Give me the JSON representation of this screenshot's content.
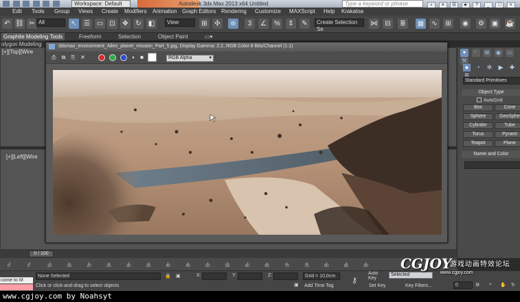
{
  "titlebar": {
    "workspace": "Workspace: Default",
    "app_title": "Autodesk 3ds Max  2013 x64      Untitled",
    "search_placeholder": "Type a keyword or phrase"
  },
  "menu": [
    "Edit",
    "Tools",
    "Group",
    "Views",
    "Create",
    "Modifiers",
    "Animation",
    "Graph Editors",
    "Rendering",
    "Customize",
    "MAXScript",
    "Help",
    "Krakatoa"
  ],
  "toolbar": {
    "filter_value": "All",
    "refcoord_value": "View",
    "selection_set_placeholder": "Create Selection Se"
  },
  "ribbon": {
    "tabs": [
      "Graphite Modeling Tools",
      "Freeform",
      "Selection",
      "Object Paint"
    ],
    "sub_label": "olygon Modeling"
  },
  "viewports": {
    "top_label": "[+][Top][Wire",
    "left_label": "[+][Left][Wire"
  },
  "render_window": {
    "title": "3dsmax_environment_Alien_planet_mission_Part_5.jpg, Display Gamma: 2.2, RGB Color 8 Bits/Channel (1:1)",
    "channel_select": "RGB Alpha",
    "channel_colors": [
      "#d92b2b",
      "#2ea84a",
      "#2c4fd6"
    ]
  },
  "command_panel": {
    "dropdown": "Standard Primitives",
    "object_type_header": "Object Type",
    "autogrid_label": "AutoGrid",
    "primitives": [
      [
        "Box",
        "Cone"
      ],
      [
        "Sphere",
        "GeoSphe"
      ],
      [
        "Cylinder",
        "Tube"
      ],
      [
        "Torus",
        "Pyrami"
      ],
      [
        "Teapot",
        "Plane"
      ]
    ],
    "name_color_header": "Name and Color"
  },
  "timeline": {
    "frame_counter": "0 / 100",
    "ticks": [
      "0",
      "5",
      "10",
      "15",
      "20",
      "25",
      "30",
      "35",
      "40",
      "45",
      "50",
      "55",
      "60",
      "65",
      "70",
      "75",
      "80",
      "85",
      "90"
    ]
  },
  "status": {
    "selection": "None Selected",
    "prompt": "Click or click-and-drag to select objects",
    "x_label": "X:",
    "y_label": "Y:",
    "z_label": "Z:",
    "grid": "Grid = 10,0cm",
    "add_time_tag": "Add Time Tag",
    "auto_key": "Auto Key",
    "auto_key_value": "Selected",
    "set_key": "Set Key",
    "key_filters": "Key Filters...",
    "frame_field": "0",
    "maxscript_text": "come to M"
  },
  "watermark": {
    "brand": "CGJOY",
    "cn": "游戏动画特效论坛",
    "url": "www.cgjoy.com"
  },
  "footer": {
    "credit": "www.cgjoy.com by Noahsyt"
  }
}
